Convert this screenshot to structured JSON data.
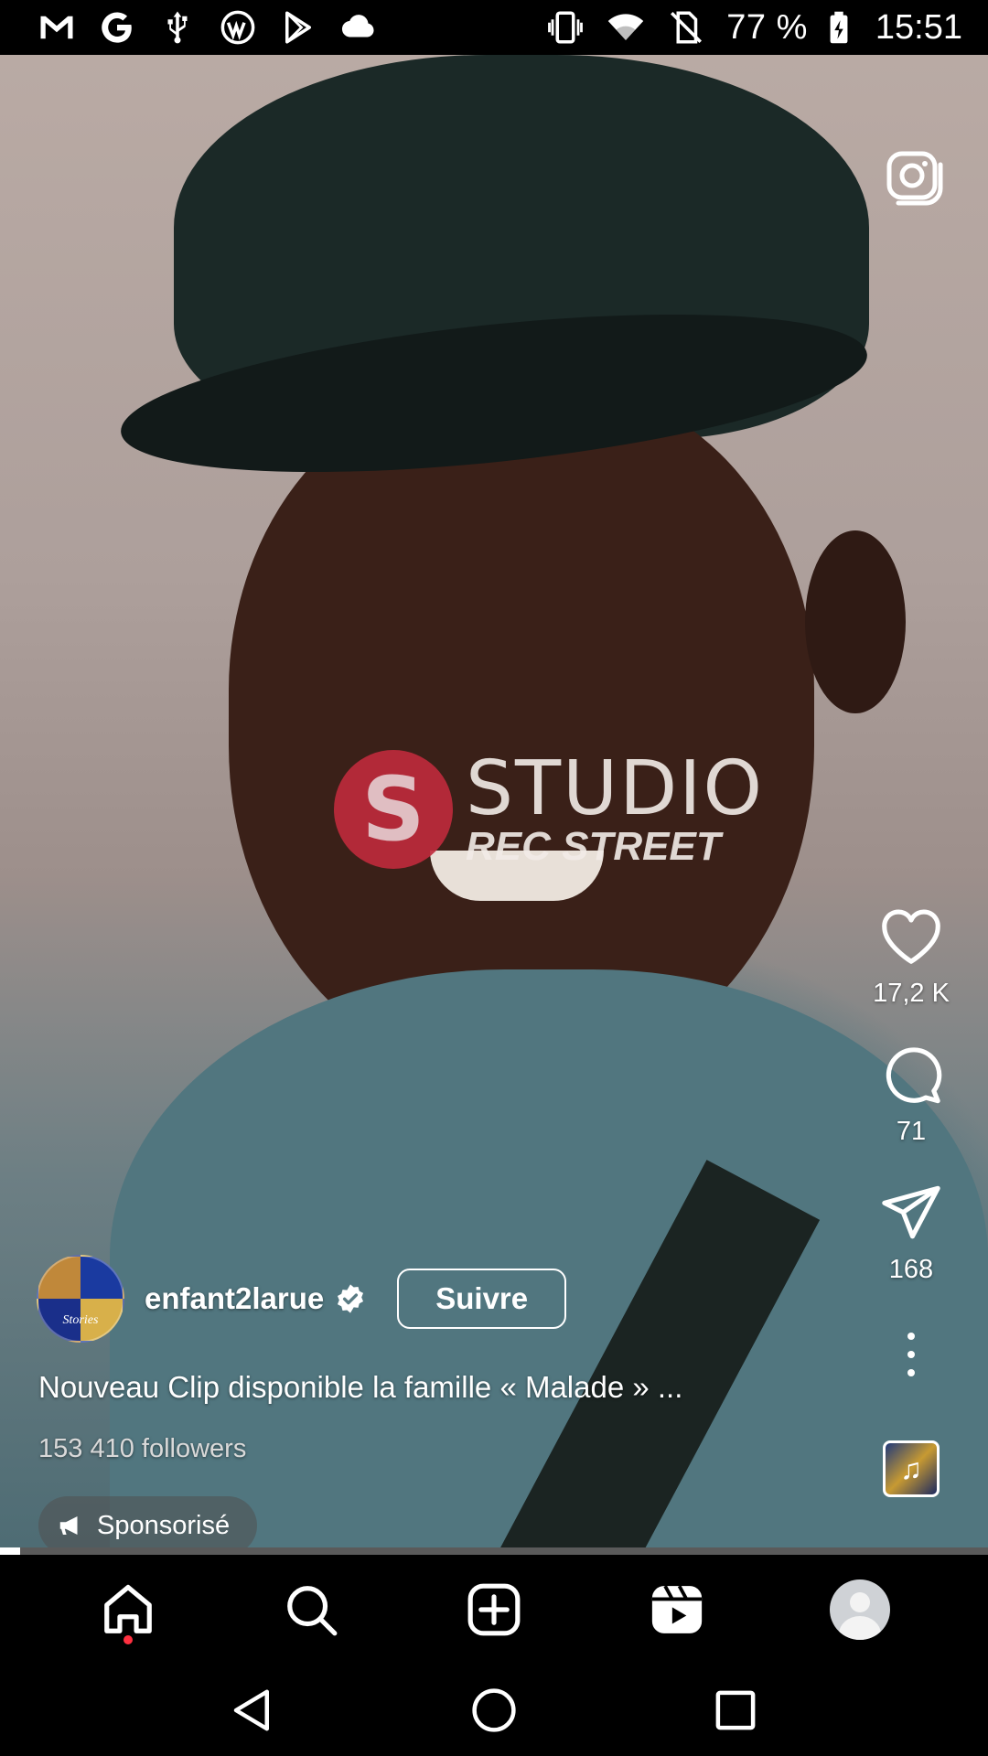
{
  "status_bar": {
    "battery": "77 %",
    "time": "15:51",
    "left_icons": [
      "gmail-icon",
      "google-icon",
      "usb-icon",
      "wp-icon",
      "play-store-icon",
      "cloud-icon"
    ],
    "right_icons": [
      "vibrate-icon",
      "wifi-icon",
      "no-sim-icon",
      "battery-charging-icon"
    ]
  },
  "watermark": {
    "logo_letter": "S",
    "line1": "STUDIO",
    "line2": "REC STREET"
  },
  "actions": {
    "likes": "17,2 K",
    "comments": "71",
    "shares": "168"
  },
  "post": {
    "username": "enfant2larue",
    "avatar_label": "Stories",
    "follow_label": "Suivre",
    "caption": "Nouveau Clip disponible la famille « Malade » ...",
    "followers": "153 410 followers",
    "sponsored_label": "Sponsorisé",
    "verified": true
  },
  "progress": {
    "value": 0.02
  },
  "colors": {
    "accent_notification": "#ff3040",
    "background": "#000000",
    "text": "#ffffff"
  },
  "bottom_nav": [
    "home-icon",
    "search-icon",
    "create-icon",
    "reels-icon",
    "profile-avatar"
  ]
}
